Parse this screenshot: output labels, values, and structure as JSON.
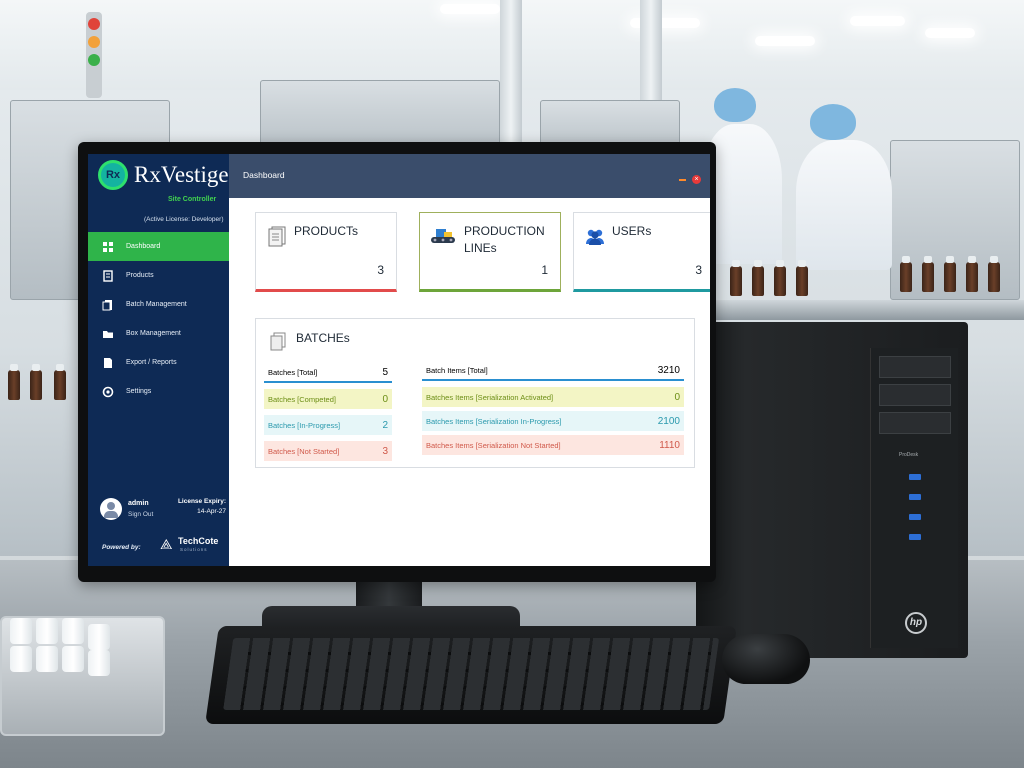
{
  "app": {
    "brand": "RxVestige",
    "badge": "Rx",
    "subtitle": "Site Controller",
    "license": "(Active License: Developer)",
    "window_title": "Dashboard"
  },
  "nav": [
    {
      "label": "Dashboard",
      "icon": "dashboard-icon",
      "active": true
    },
    {
      "label": "Products",
      "icon": "products-icon"
    },
    {
      "label": "Batch Management",
      "icon": "batch-icon"
    },
    {
      "label": "Box Management",
      "icon": "box-icon"
    },
    {
      "label": "Export / Reports",
      "icon": "reports-icon"
    },
    {
      "label": "Settings",
      "icon": "settings-icon"
    }
  ],
  "user": {
    "name": "admin",
    "sign_out": "Sign Out",
    "expiry_label": "License Expiry:",
    "expiry_date": "14-Apr-27"
  },
  "footer": {
    "powered_by": "Powered by:",
    "vendor": "TechCote",
    "vendor_sub": "Solutions"
  },
  "cards": {
    "products": {
      "title": "PRODUCTs",
      "value": "3"
    },
    "lines": {
      "title_1": "PRODUCTION",
      "title_2": "LINEs",
      "value": "1"
    },
    "users": {
      "title": "USERs",
      "value": "3"
    }
  },
  "batches": {
    "title": "BATCHEs",
    "left": [
      {
        "label": "Batches [Total]",
        "value": "5"
      },
      {
        "label": "Batches [Competed]",
        "value": "0"
      },
      {
        "label": "Batches [In-Progress]",
        "value": "2"
      },
      {
        "label": "Batches [Not Started]",
        "value": "3"
      }
    ],
    "right": [
      {
        "label": "Batch Items [Total]",
        "value": "3210"
      },
      {
        "label": "Batches Items [Serialization Activated]",
        "value": "0"
      },
      {
        "label": "Batches Items [Serialization In-Progress]",
        "value": "2100"
      },
      {
        "label": "Batches Items [Serialization Not Started]",
        "value": "1110"
      }
    ]
  },
  "hardware": {
    "tower_brand": "hp",
    "tower_label": "ProDesk"
  },
  "colors": {
    "sidebar": "#0e2a55",
    "active_nav": "#2fb44a",
    "titlebar": "#3a4d6b",
    "products_accent": "#e24b4b",
    "lines_accent": "#6da53a",
    "users_accent": "#1f9aa0"
  }
}
